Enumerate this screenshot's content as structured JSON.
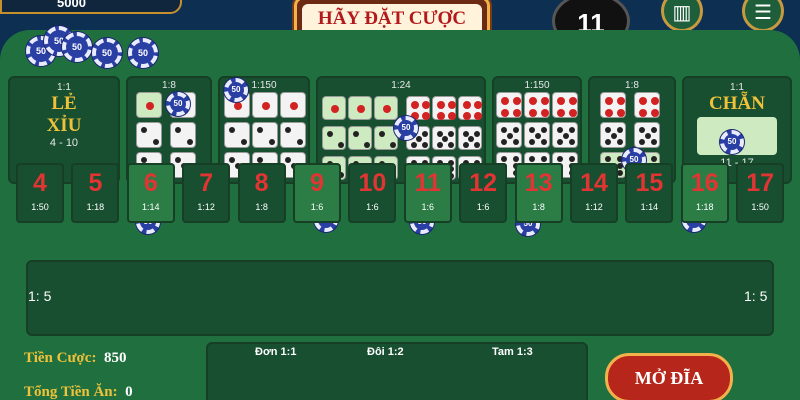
{
  "header": {
    "balance": "5000",
    "title": "HÃY ĐẶT CƯỢC",
    "timer": "11"
  },
  "big_bets": {
    "small": {
      "odds": "1:1",
      "label1": "LẺ",
      "label2": "XỈU",
      "range": "4 - 10"
    },
    "big": {
      "odds": "1:1",
      "label1": "CHẴN",
      "range": "11 - 17"
    }
  },
  "combo_odds": [
    "1:8",
    "1:150",
    "1:24",
    "1:150",
    "1:8"
  ],
  "numbers": [
    {
      "n": "4",
      "o": "1:50"
    },
    {
      "n": "5",
      "o": "1:18"
    },
    {
      "n": "6",
      "o": "1:14"
    },
    {
      "n": "7",
      "o": "1:12"
    },
    {
      "n": "8",
      "o": "1:8"
    },
    {
      "n": "9",
      "o": "1:6"
    },
    {
      "n": "10",
      "o": "1:6"
    },
    {
      "n": "11",
      "o": "1:6"
    },
    {
      "n": "12",
      "o": "1:6"
    },
    {
      "n": "13",
      "o": "1:8"
    },
    {
      "n": "14",
      "o": "1:12"
    },
    {
      "n": "15",
      "o": "1:14"
    },
    {
      "n": "16",
      "o": "1:18"
    },
    {
      "n": "17",
      "o": "1:50"
    }
  ],
  "pair_odds": "1: 5",
  "chip_value": "50",
  "info": {
    "bet_label": "Tiền Cược:",
    "bet_value": "850",
    "win_label": "Tổng Tiền Ăn:",
    "win_value": "0"
  },
  "single_bets": {
    "don": "Đơn 1:1",
    "doi": "Đôi 1:2",
    "tam": "Tam 1:3"
  },
  "open_button": "MỞ ĐĨA",
  "colors": {
    "felt": "#20703f",
    "cell": "#174f30",
    "gold": "#f0c23a",
    "red": "#e33434"
  }
}
